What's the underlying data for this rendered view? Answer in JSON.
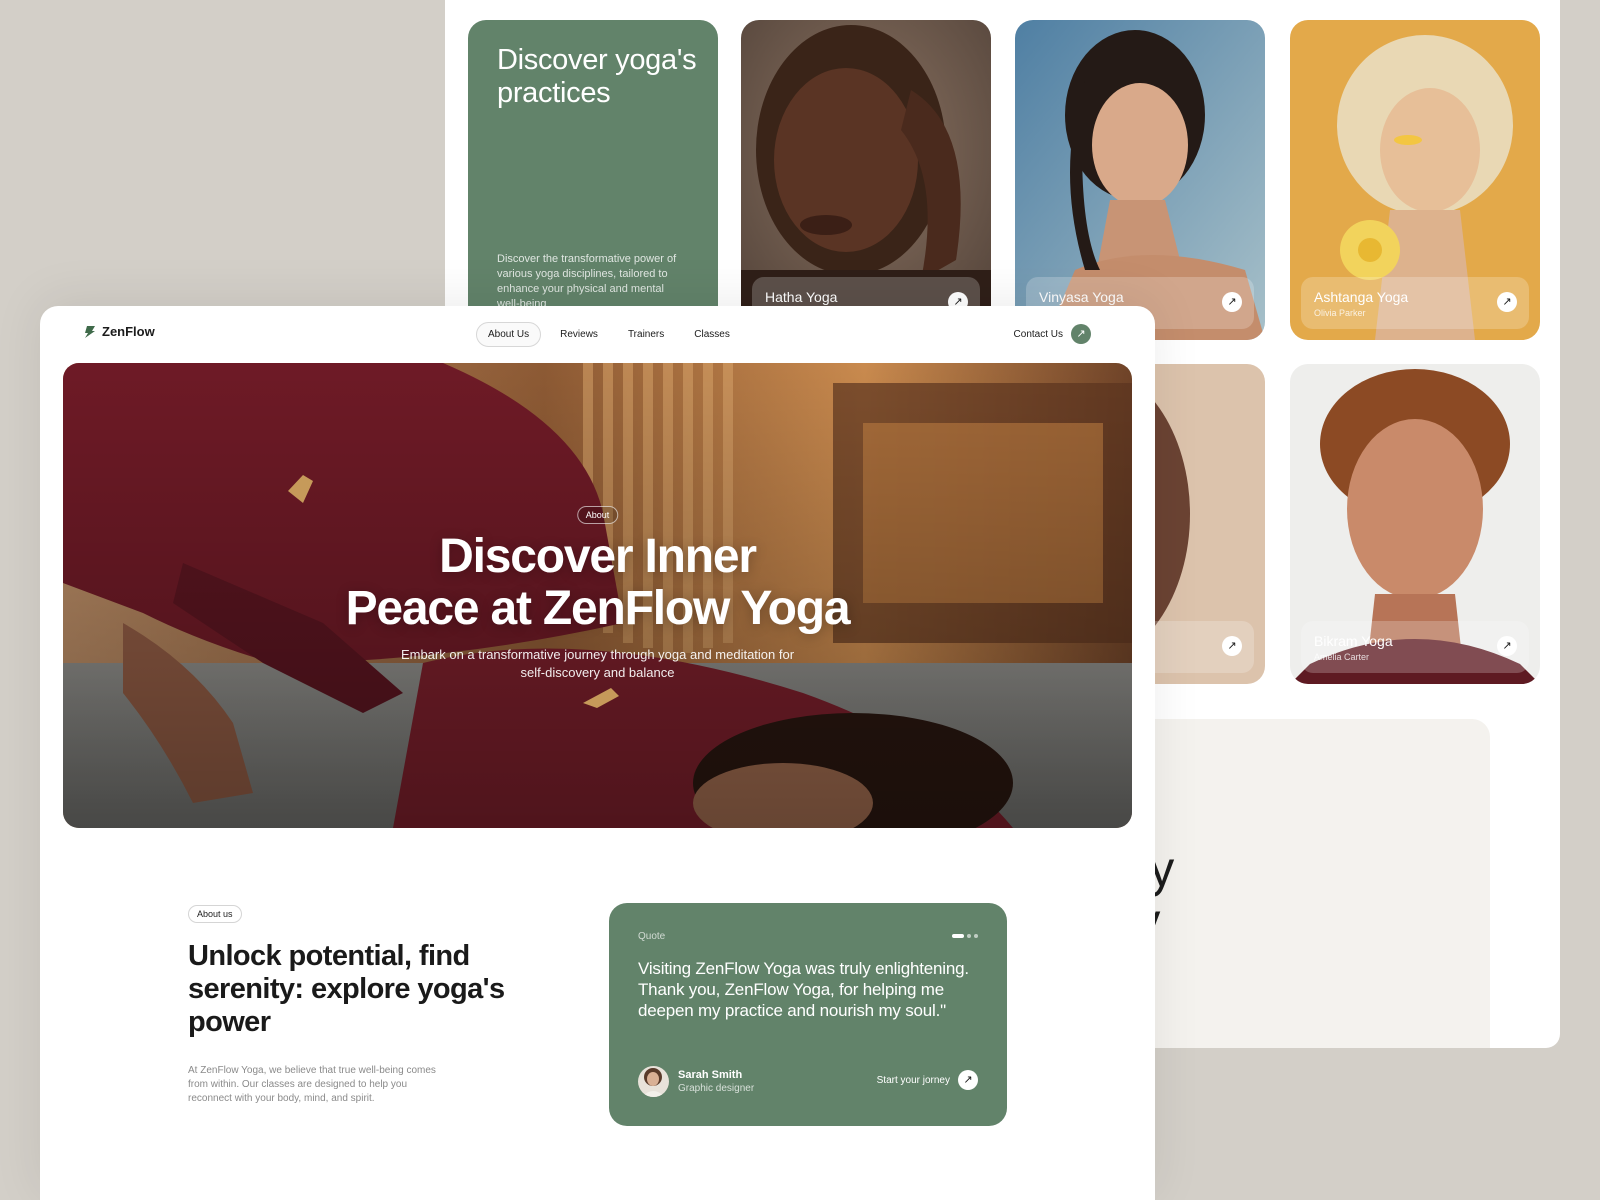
{
  "colors": {
    "accent_green": "#62836a",
    "backdrop": "#d3cfc8",
    "panel_beige": "#f4f2ee"
  },
  "practices": {
    "title": "Discover yoga's practices",
    "description": "Discover the transformative power of various yoga disciplines, tailored to enhance your physical and mental well-being",
    "cards": [
      {
        "name": "Hatha Yoga",
        "trainer": ""
      },
      {
        "name": "Vinyasa Yoga",
        "trainer": ""
      },
      {
        "name": "Ashtanga Yoga",
        "trainer": "Olivia Parker"
      },
      {
        "name": "Bikram Yoga",
        "trainer": "Amelia Carter"
      }
    ],
    "arrow_icon": "arrow-up-right-icon"
  },
  "journey": {
    "line1": "rney",
    "line2": "tery"
  },
  "nav": {
    "brand": "ZenFlow",
    "items": [
      "About Us",
      "Reviews",
      "Trainers",
      "Classes"
    ],
    "active_item": "About Us",
    "contact_label": "Contact Us"
  },
  "hero": {
    "badge": "About",
    "title_line1": "Discover Inner",
    "title_line2": "Peace at ZenFlow Yoga",
    "subtitle": "Embark on a transformative journey through yoga and meditation for self-discovery and balance"
  },
  "about": {
    "badge": "About us",
    "title": "Unlock potential, find serenity: explore yoga's power",
    "text": "At ZenFlow Yoga, we believe that true well-being comes from within. Our classes are designed to help you reconnect with your body, mind, and spirit."
  },
  "quote": {
    "label": "Quote",
    "text": "Visiting ZenFlow Yoga was truly enlightening. Thank you, ZenFlow Yoga, for helping me deepen my practice and nourish my soul.\"",
    "author_name": "Sarah Smith",
    "author_role": "Graphic designer",
    "cta": "Start your jorney",
    "slide_count": 3,
    "active_slide": 1
  }
}
